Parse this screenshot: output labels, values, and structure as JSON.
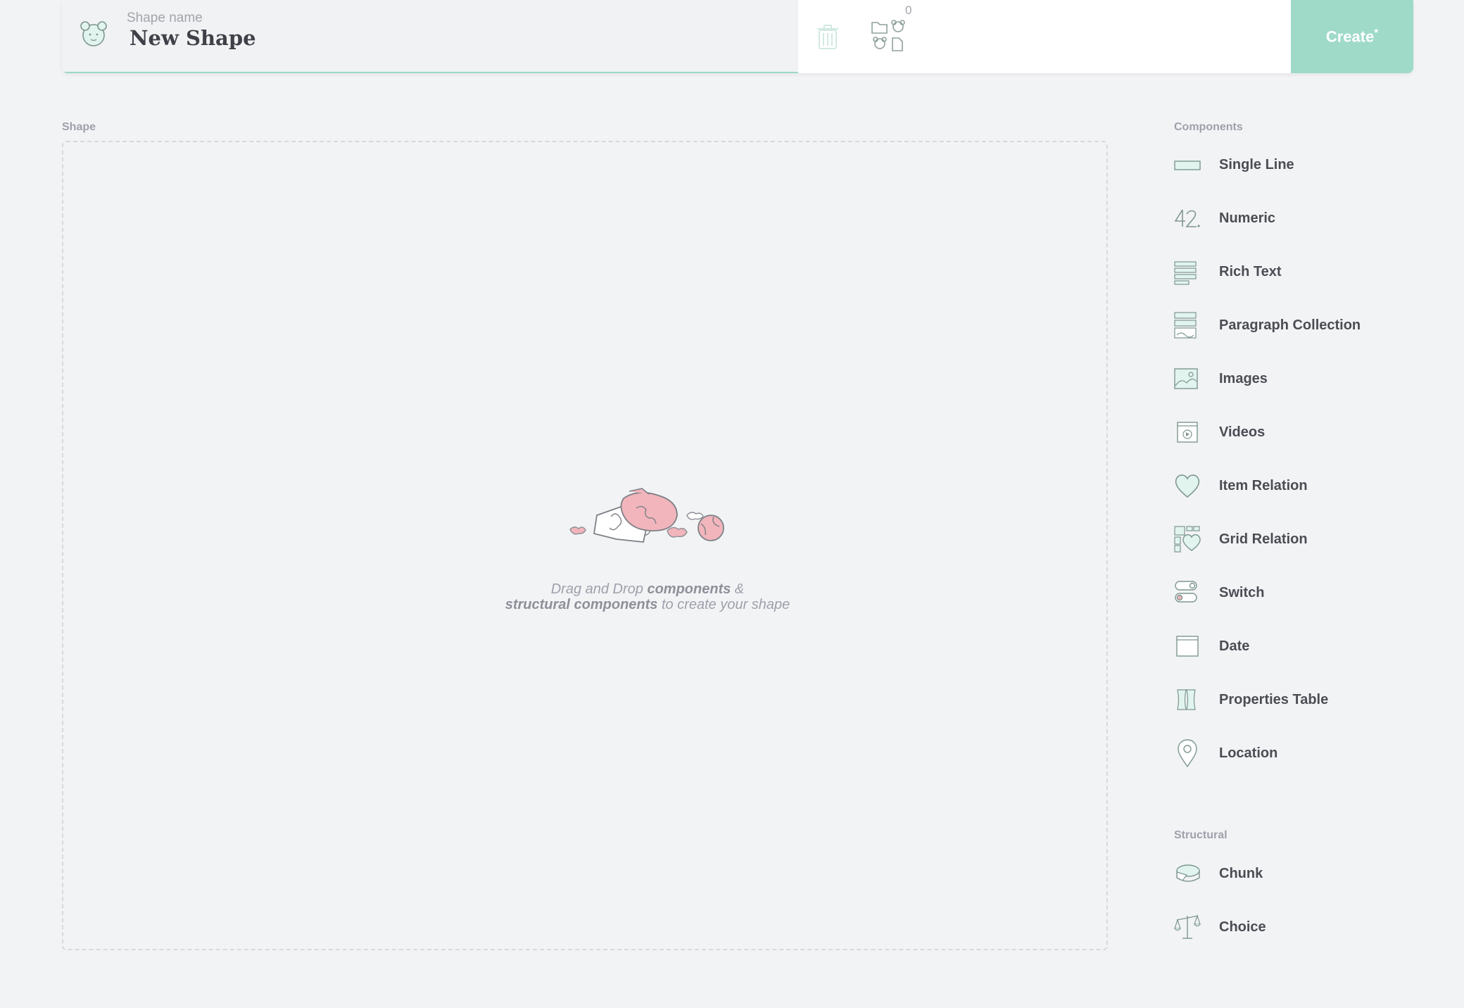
{
  "header": {
    "name_label": "Shape name",
    "name_value": "New Shape",
    "files_count": "0",
    "create_label": "Create",
    "create_marker": "*"
  },
  "shape_area": {
    "label": "Shape",
    "empty_message": {
      "part1": "Drag and Drop ",
      "bold1": "components",
      "part2": " & ",
      "bold2": "structural components",
      "part3": " to create your shape"
    }
  },
  "components": {
    "label": "Components",
    "items": [
      {
        "label": "Single Line",
        "icon": "single-line-icon"
      },
      {
        "label": "Numeric",
        "icon": "numeric-icon"
      },
      {
        "label": "Rich Text",
        "icon": "rich-text-icon"
      },
      {
        "label": "Paragraph Collection",
        "icon": "paragraph-collection-icon"
      },
      {
        "label": "Images",
        "icon": "images-icon"
      },
      {
        "label": "Videos",
        "icon": "videos-icon"
      },
      {
        "label": "Item Relation",
        "icon": "heart-icon"
      },
      {
        "label": "Grid Relation",
        "icon": "grid-relation-icon"
      },
      {
        "label": "Switch",
        "icon": "switch-icon"
      },
      {
        "label": "Date",
        "icon": "calendar-icon"
      },
      {
        "label": "Properties Table",
        "icon": "properties-table-icon"
      },
      {
        "label": "Location",
        "icon": "location-pin-icon"
      }
    ]
  },
  "structural": {
    "label": "Structural",
    "items": [
      {
        "label": "Chunk",
        "icon": "chunk-icon"
      },
      {
        "label": "Choice",
        "icon": "scale-icon"
      }
    ]
  },
  "colors": {
    "accent": "#9fdac8",
    "icon_stroke": "#7e9690",
    "icon_fill": "#e1f4ee",
    "illustration_pink": "#f2b5bc",
    "background": "#f2f3f5"
  }
}
